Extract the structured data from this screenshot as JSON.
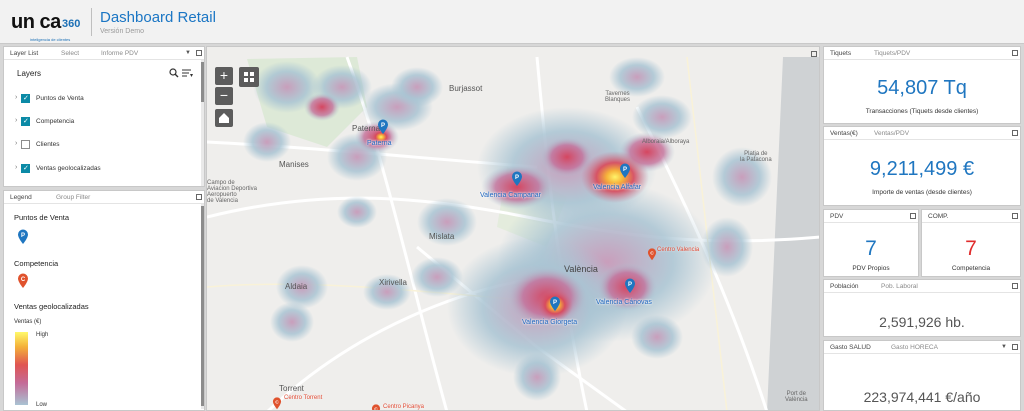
{
  "header": {
    "logo_text": "un ca",
    "logo_num": "360",
    "logo_tagline": "inteligencia de clientes",
    "title": "Dashboard Retail",
    "subtitle": "Versión Demo"
  },
  "layer_panel": {
    "tabs": [
      "Layer List",
      "Select",
      "Informe PDV"
    ],
    "title": "Layers",
    "layers": [
      {
        "label": "Puntos de Venta",
        "checked": true
      },
      {
        "label": "Competencia",
        "checked": true
      },
      {
        "label": "Clientes",
        "checked": false
      },
      {
        "label": "Ventas geolocalizadas",
        "checked": true
      }
    ]
  },
  "legend_panel": {
    "tabs": [
      "Legend",
      "Group Filter"
    ],
    "pdv_title": "Puntos de Venta",
    "comp_title": "Competencia",
    "ventas_title": "Ventas geolocalizadas",
    "ventas_unit": "Ventas (€)",
    "high": "High",
    "low": "Low"
  },
  "map": {
    "places": [
      {
        "id": "burjassot",
        "label": "Burjassot"
      },
      {
        "id": "tavernes",
        "label": "Tavernes\nBlanques"
      },
      {
        "id": "alboraia",
        "label": "Alboraia/Alboraya"
      },
      {
        "id": "paterna",
        "label": "Paterna"
      },
      {
        "id": "manises",
        "label": "Manises"
      },
      {
        "id": "campo",
        "label": "Campo de\nAviacion Deportiva\nAeropuerto\nde Valencia"
      },
      {
        "id": "playa",
        "label": "Platja de\nla Patacona"
      },
      {
        "id": "mislata",
        "label": "Mislata"
      },
      {
        "id": "valencia",
        "label": "València"
      },
      {
        "id": "xirivella",
        "label": "Xirivella"
      },
      {
        "id": "aldaia",
        "label": "Aldaia"
      },
      {
        "id": "torrent",
        "label": "Torrent"
      },
      {
        "id": "port",
        "label": "Port de\nValència"
      }
    ],
    "pdv": [
      {
        "label": "Paterna"
      },
      {
        "label": "Valencia Campanar"
      },
      {
        "label": "Valencia Alfafar"
      },
      {
        "label": "Valencia Cánovas"
      },
      {
        "label": "Valencia Giorgeta"
      }
    ],
    "competencia": [
      {
        "label": "Centro Valencia"
      },
      {
        "label": "Centro Torrent"
      },
      {
        "label": "Centro Picanya"
      }
    ],
    "zoom_in": "+",
    "zoom_out": "−"
  },
  "kpis": {
    "tickets": {
      "tabs": [
        "Tiquets",
        "Tiquets/PDV"
      ],
      "value": "54,807 Tq",
      "caption": "Transacciones (Tiquets desde clientes)"
    },
    "ventas": {
      "tabs": [
        "Ventas(€)",
        "Ventas/PDV"
      ],
      "value": "9,211,499 €",
      "caption": "Importe de ventas (desde clientes)"
    },
    "pdv": {
      "tab": "PDV",
      "value": "7",
      "caption": "PDV Propios"
    },
    "comp": {
      "tab": "COMP.",
      "value": "7",
      "caption": "Competencia"
    },
    "poblacion": {
      "tabs": [
        "Población",
        "Pob. Laboral"
      ],
      "value": "2,591,926 hb."
    },
    "gasto": {
      "tabs": [
        "Gasto SALUD",
        "Gasto HORECA"
      ],
      "value": "223,974,441 €/año"
    }
  },
  "colors": {
    "accent": "#1f76c0",
    "competencia": "#e24b35",
    "checkbox": "#0b8aa6"
  }
}
